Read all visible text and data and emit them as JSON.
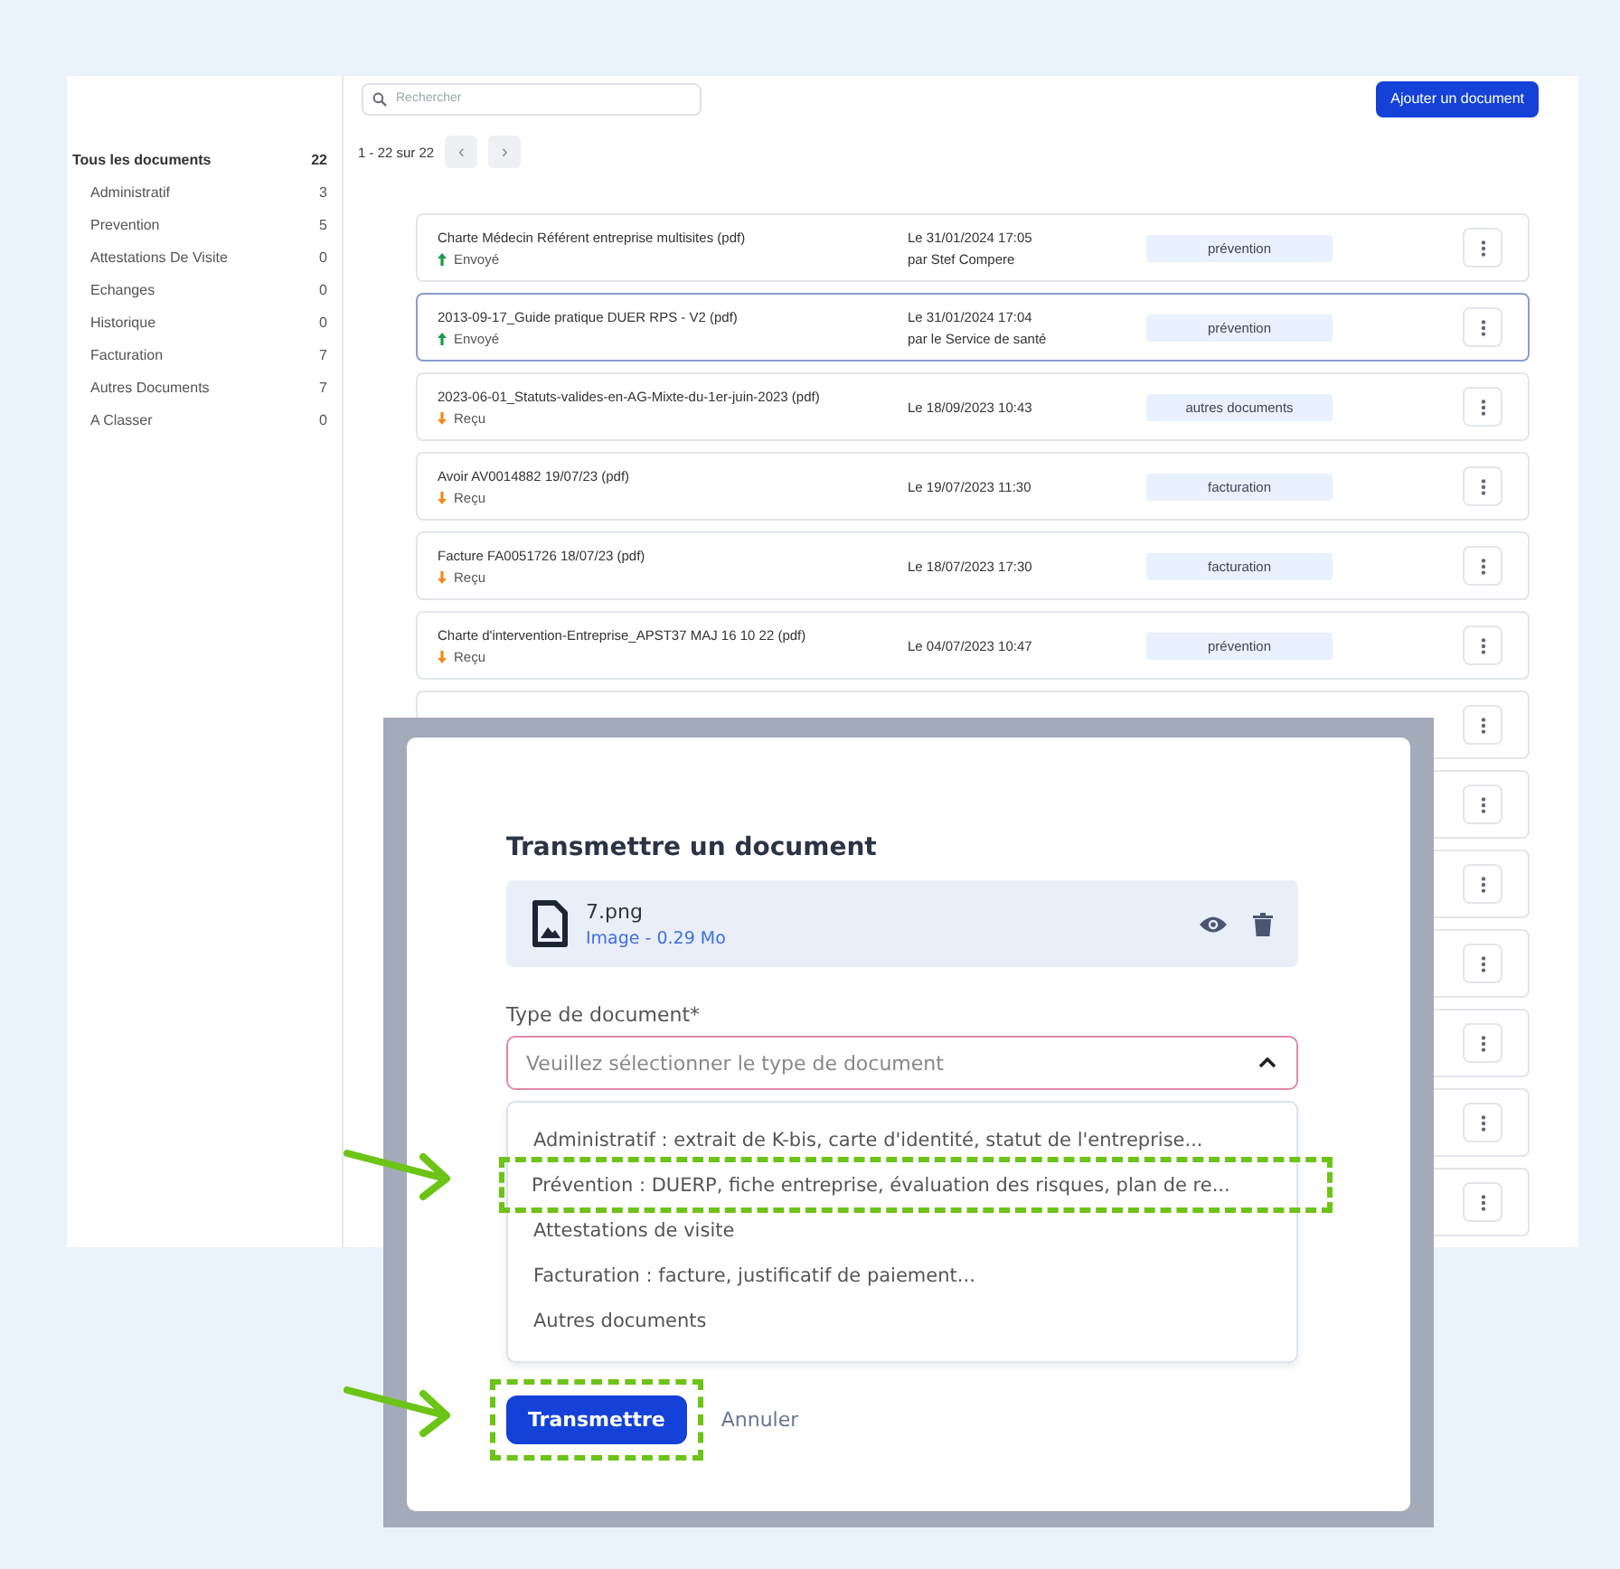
{
  "toolbar": {
    "search": {
      "placeholder": "Rechercher"
    },
    "add_button": "Ajouter un document"
  },
  "sidebar": {
    "items": [
      {
        "label": "Tous les documents",
        "count": "22",
        "selected": true,
        "children": [
          {
            "label": "Administratif",
            "count": "3",
            "selected": false
          },
          {
            "label": "Prevention",
            "count": "5",
            "selected": false
          },
          {
            "label": "Attestations De Visite",
            "count": "0",
            "selected": false
          },
          {
            "label": "Echanges",
            "count": "0",
            "selected": false
          },
          {
            "label": "Historique",
            "count": "0",
            "selected": false
          },
          {
            "label": "Facturation",
            "count": "7",
            "selected": false
          },
          {
            "label": "Autres Documents",
            "count": "7",
            "selected": false
          },
          {
            "label": "A Classer",
            "count": "0",
            "selected": false
          }
        ]
      }
    ]
  },
  "pagination": {
    "range": "1 - 22 sur 22",
    "prev": "‹",
    "next": "›"
  },
  "documents": [
    {
      "kind": "document",
      "name": "Charte Médecin Référent entreprise multisites (pdf)",
      "status": {
        "kind": "sent",
        "label": "Envoyé"
      },
      "date": "Le 31/01/2024 17:05",
      "author": "par Stef Compere",
      "tag": "prévention",
      "selected": false
    },
    {
      "kind": "document",
      "name": "2013-09-17_Guide pratique DUER RPS - V2 (pdf)",
      "status": {
        "kind": "sent",
        "label": "Envoyé"
      },
      "date": "Le 31/01/2024 17:04",
      "author": "par le Service de santé",
      "tag": "prévention",
      "selected": true
    },
    {
      "kind": "document",
      "name": "2023-06-01_Statuts-valides-en-AG-Mixte-du-1er-juin-2023 (pdf)",
      "status": {
        "kind": "received",
        "label": "Reçu"
      },
      "date": "Le 18/09/2023 10:43",
      "tag": "autres documents",
      "selected": false
    },
    {
      "kind": "document",
      "name": "Avoir AV0014882 19/07/23 (pdf)",
      "status": {
        "kind": "received",
        "label": "Reçu"
      },
      "date": "Le 19/07/2023 11:30",
      "tag": "facturation",
      "selected": false
    },
    {
      "kind": "document",
      "name": "Facture FA0051726 18/07/23 (pdf)",
      "status": {
        "kind": "received",
        "label": "Reçu"
      },
      "date": "Le 18/07/2023 17:30",
      "tag": "facturation",
      "selected": false
    },
    {
      "kind": "document",
      "name": "Charte d'intervention-Entreprise_APST37 MAJ 16 10 22 (pdf)",
      "status": {
        "kind": "received",
        "label": "Reçu"
      },
      "date": "Le 04/07/2023 10:47",
      "tag": "prévention",
      "selected": false
    },
    {
      "kind": "covered",
      "selected": false
    },
    {
      "kind": "covered",
      "selected": false
    },
    {
      "kind": "covered",
      "selected": false
    },
    {
      "kind": "covered",
      "selected": false
    },
    {
      "kind": "covered",
      "selected": false
    },
    {
      "kind": "covered",
      "selected": false
    },
    {
      "kind": "covered",
      "selected": false
    }
  ],
  "dialog": {
    "title": "Transmettre un document",
    "file": {
      "name": "7.png",
      "details": "Image - 0.29 Mo"
    },
    "field": {
      "label": "Type de document*",
      "placeholder": "Veuillez sélectionner le type de document",
      "expanded": true,
      "options": [
        {
          "label": "Administratif : extrait de K-bis, carte d'identité, statut de l'entreprise...",
          "selected": false,
          "highlighted": false
        },
        {
          "label": "Prévention : DUERP, fiche entreprise, évaluation des risques, plan de re...",
          "selected": false,
          "highlighted": true
        },
        {
          "label": "Attestations de visite",
          "selected": false,
          "highlighted": false
        },
        {
          "label": "Facturation : facture, justificatif de paiement...",
          "selected": false,
          "highlighted": false
        },
        {
          "label": "Autres documents",
          "selected": false,
          "highlighted": false
        }
      ]
    },
    "submit": {
      "label": "Transmettre",
      "highlighted": true
    },
    "cancel": "Annuler"
  }
}
